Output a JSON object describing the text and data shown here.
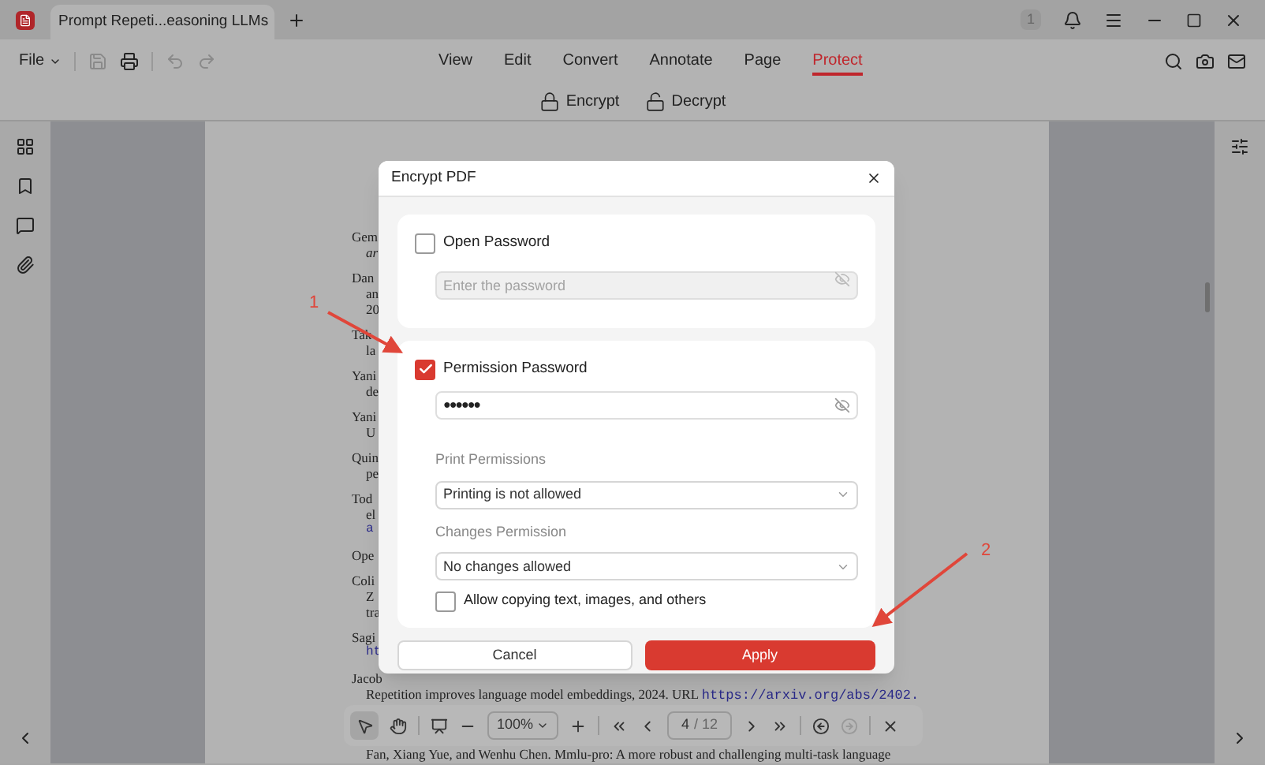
{
  "tab": {
    "title": "Prompt Repeti...easoning LLMs"
  },
  "title_bar": {
    "badge": "1"
  },
  "menu": {
    "file": "File",
    "items": [
      {
        "label": "View",
        "selected": false
      },
      {
        "label": "Edit",
        "selected": false
      },
      {
        "label": "Convert",
        "selected": false
      },
      {
        "label": "Annotate",
        "selected": false
      },
      {
        "label": "Page",
        "selected": false
      },
      {
        "label": "Protect",
        "selected": true
      }
    ]
  },
  "ribbon": [
    "Encrypt",
    "Decrypt"
  ],
  "document": {
    "references": [
      {
        "text": "Gem",
        "continued": [
          {
            "text": "ar",
            "kind": "italic"
          }
        ]
      },
      {
        "text": "Dan",
        "continued": [
          {
            "text": "an",
            "kind": "plain"
          },
          {
            "text": "20",
            "kind": "plain"
          }
        ]
      },
      {
        "text": "Tak",
        "continued": [
          {
            "text": "la",
            "kind": "plain"
          }
        ]
      },
      {
        "text": "Yani",
        "continued": [
          {
            "text": "de",
            "kind": "plain"
          }
        ]
      },
      {
        "text": "Yani",
        "continued": [
          {
            "text": "U",
            "kind": "plain"
          }
        ]
      },
      {
        "text": "Quin",
        "continued": [
          {
            "text": "pe",
            "kind": "plain"
          }
        ]
      },
      {
        "text": "Tod",
        "continued": [
          {
            "text": "el",
            "kind": "plain"
          },
          {
            "text": "a",
            "kind": "link"
          }
        ]
      },
      {
        "text": "Ope"
      },
      {
        "text": "Coli",
        "continued": [
          {
            "text": "Z",
            "kind": "plain"
          },
          {
            "text": "tra",
            "kind": "plain"
          }
        ]
      },
      {
        "text": "Sagi",
        "continued": [
          {
            "text": "ht",
            "kind": "link"
          }
        ]
      },
      {
        "text": "Jacob"
      }
    ],
    "full_line": {
      "text": "Repetition improves language model embeddings, 2024. URL",
      "link": "https://arxiv.org/abs/2402."
    },
    "bottom_line": "Fan, Xiang Yue, and Wenhu Chen. Mmlu-pro: A more robust and challenging multi-task language"
  },
  "dialog": {
    "title": "Encrypt PDF",
    "open_password": {
      "label": "Open Password",
      "checked": false,
      "placeholder": "Enter the password"
    },
    "permission_password": {
      "label": "Permission Password",
      "checked": true,
      "value": "●●●●●●",
      "print_label": "Print Permissions",
      "print_value": "Printing is not allowed",
      "changes_label": "Changes Permission",
      "changes_value": "No changes allowed",
      "allow_copy": {
        "label": "Allow copying text, images, and others",
        "checked": false
      }
    },
    "buttons": [
      {
        "label": "Cancel",
        "kind": "secondary"
      },
      {
        "label": "Apply",
        "kind": "primary"
      }
    ]
  },
  "annotations": [
    "1",
    "2"
  ],
  "bottom_toolbar": {
    "zoom": "100%",
    "page": "4",
    "total": "/ 12"
  }
}
